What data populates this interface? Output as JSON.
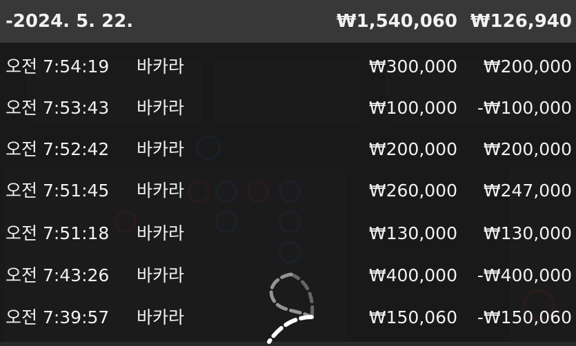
{
  "summary": {
    "date": "-2024. 5. 22.",
    "total_bet": "₩1,540,060",
    "total_win": "₩126,940"
  },
  "history": [
    {
      "time": "오전 7:54:19",
      "game": "바카라",
      "bet": "₩300,000",
      "win": "₩200,000"
    },
    {
      "time": "오전 7:53:43",
      "game": "바카라",
      "bet": "₩100,000",
      "win": "-₩100,000"
    },
    {
      "time": "오전 7:52:42",
      "game": "바카라",
      "bet": "₩200,000",
      "win": "₩200,000"
    },
    {
      "time": "오전 7:51:45",
      "game": "바카라",
      "bet": "₩260,000",
      "win": "₩247,000"
    },
    {
      "time": "오전 7:51:18",
      "game": "바카라",
      "bet": "₩130,000",
      "win": "₩130,000"
    },
    {
      "time": "오전 7:43:26",
      "game": "바카라",
      "bet": "₩400,000",
      "win": "-₩400,000"
    },
    {
      "time": "오전 7:39:57",
      "game": "바카라",
      "bet": "₩150,060",
      "win": "-₩150,060"
    }
  ],
  "colors": {
    "overlay": "#141414",
    "header_bg": "#3e3e3e",
    "text": "#f2f2f2",
    "bg_red": "#c0392b",
    "bg_blue": "#2e6fd0"
  }
}
